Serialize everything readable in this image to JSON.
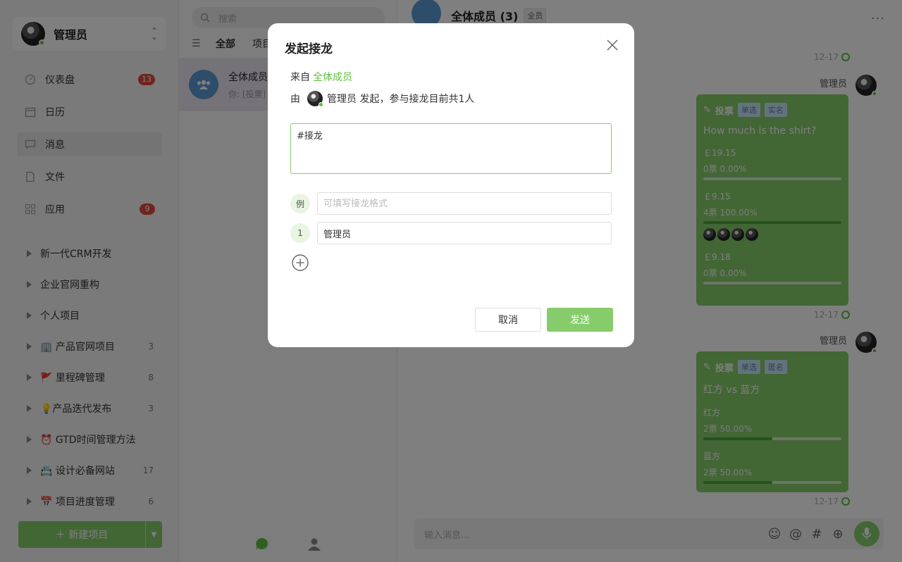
{
  "sidebar": {
    "user_name": "管理员",
    "nav": [
      {
        "label": "仪表盘",
        "badge": "13",
        "icon": "dashboard-icon"
      },
      {
        "label": "日历",
        "badge": "",
        "icon": "calendar-icon"
      },
      {
        "label": "消息",
        "badge": "",
        "icon": "message-icon"
      },
      {
        "label": "文件",
        "badge": "",
        "icon": "file-icon"
      },
      {
        "label": "应用",
        "badge": "9",
        "icon": "apps-icon"
      }
    ],
    "projects": [
      {
        "label": "新一代CRM开发",
        "count": ""
      },
      {
        "label": "企业官网重构",
        "count": ""
      },
      {
        "label": "个人项目",
        "count": ""
      },
      {
        "label": "🏢 产品官网项目",
        "count": "3"
      },
      {
        "label": "🚩 里程碑管理",
        "count": "8"
      },
      {
        "label": "💡产品迭代发布",
        "count": "3"
      },
      {
        "label": "⏰ GTD时间管理方法",
        "count": ""
      },
      {
        "label": "📇 设计必备网站",
        "count": "17"
      },
      {
        "label": "📅 项目进度管理",
        "count": "6"
      }
    ],
    "new_project": "新建项目"
  },
  "middle": {
    "search_placeholder": "搜索",
    "tabs": [
      "全部",
      "项目"
    ],
    "conversation": {
      "title": "全体成员",
      "preview": "你: [投票]"
    }
  },
  "chat": {
    "title": "全体成员 (3)",
    "tag": "全员",
    "times": [
      "12-17",
      "12-17",
      "12-17"
    ],
    "sender": "管理员",
    "votes": [
      {
        "label": "投票",
        "tags": [
          "单选",
          "实名"
        ],
        "question": "How much is the shirt?",
        "options": [
          {
            "name": "￡19.15",
            "stat": "0票   0.00%",
            "pct": 0
          },
          {
            "name": "￡9.15",
            "stat": "4票   100.00%",
            "pct": 100
          },
          {
            "name": "￡9.18",
            "stat": "0票   0.00%",
            "pct": 0
          }
        ]
      },
      {
        "label": "投票",
        "tags": [
          "单选",
          "匿名"
        ],
        "question": "红方 vs 蓝方",
        "options": [
          {
            "name": "红方",
            "stat": "2票   50.00%",
            "pct": 50
          },
          {
            "name": "蓝方",
            "stat": "2票   50.00%",
            "pct": 50
          }
        ]
      }
    ],
    "input_placeholder": "输入消息..."
  },
  "modal": {
    "title": "发起接龙",
    "from_label": "来自",
    "from_value": "全体成员",
    "by_prefix": "由",
    "by_user": "管理员",
    "by_suffix": "发起，参与接龙目前共1人",
    "textarea_value": "#接龙\n",
    "example_label": "例",
    "example_placeholder": "可填写接龙格式",
    "entry_index": "1",
    "entry_value": "管理员",
    "cancel": "取消",
    "send": "发送"
  },
  "colors": {
    "accent": "#86cc6b",
    "badge": "#e04b3c",
    "link": "#5fbf3f"
  }
}
